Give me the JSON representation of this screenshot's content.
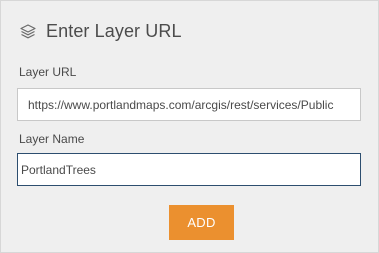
{
  "header": {
    "title": "Enter Layer URL",
    "icon": "layers-icon"
  },
  "layer_url": {
    "label": "Layer URL",
    "value": "https://www.portlandmaps.com/arcgis/rest/services/Public"
  },
  "layer_name": {
    "label": "Layer Name",
    "value": "PortlandTrees"
  },
  "actions": {
    "add_label": "ADD"
  },
  "colors": {
    "accent": "#eb902f",
    "focus_border": "#2d4e6f",
    "panel_bg": "#efefef"
  }
}
